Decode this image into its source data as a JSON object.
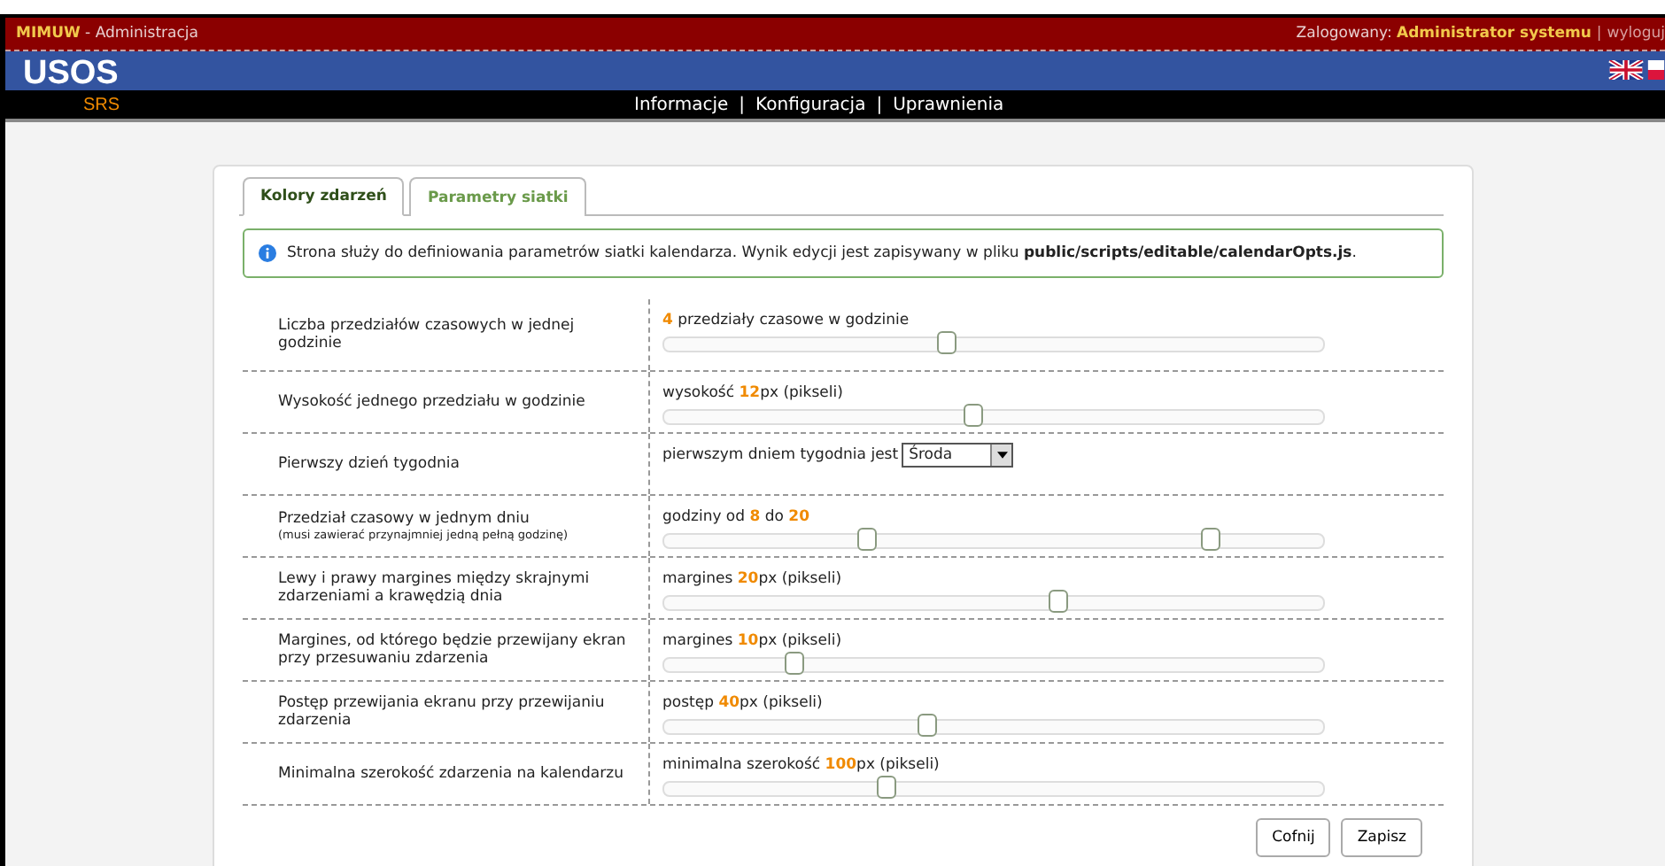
{
  "top_bar": {
    "site": "MIMUW",
    "site_suffix": " - Administracja",
    "login_label": "Zalogowany: ",
    "user": "Administrator systemu",
    "separator": "|",
    "logout": "wyloguj"
  },
  "brand": {
    "logo": "USOS",
    "sublogo": "SRS"
  },
  "nav": [
    {
      "label": "Informacje"
    },
    {
      "label": "Konfiguracja"
    },
    {
      "label": "Uprawnienia"
    }
  ],
  "nav_separator": "|",
  "tabs": [
    {
      "label": "Kolory zdarzeń",
      "selected": true
    },
    {
      "label": "Parametry siatki",
      "selected": false
    }
  ],
  "info": "Strona służy do definiowania parametrów siatki kalendarza. Wynik edycji jest zapisywany w pliku **public/scripts/editable/calendarOpts.js**.",
  "rows": [
    {
      "kind": "slider",
      "label": "Liczba przedziałów czasowych w jednej godzinie",
      "caption": [
        {
          "text": "4",
          "kind": "value"
        },
        {
          "text": " przedziały czasowe w godzinie",
          "kind": "plain"
        }
      ],
      "level": 0.43
    },
    {
      "kind": "slider",
      "label": "Wysokość jednego przedziału w godzinie",
      "caption": [
        {
          "text": "wysokość ",
          "kind": "plain"
        },
        {
          "text": "12",
          "kind": "value"
        },
        {
          "text": "px (pikseli)",
          "kind": "plain"
        }
      ],
      "level": 0.47
    },
    {
      "kind": "select",
      "label": "Pierwszy dzień tygodnia",
      "caption": [
        {
          "text": "pierwszym dniem tygodnia jest",
          "kind": "plain"
        }
      ],
      "value": "Środa"
    },
    {
      "kind": "range",
      "label": "Przedział czasowy w jednym dniu",
      "note": "(musi zawierać przynajmniej jedną pełną godzinę)",
      "caption": [
        {
          "text": "godziny od ",
          "kind": "plain"
        },
        {
          "text": "8",
          "kind": "value"
        },
        {
          "text": " do ",
          "kind": "plain"
        },
        {
          "text": "20",
          "kind": "value"
        }
      ],
      "thumbs": [
        {
          "level": 0.31
        },
        {
          "level": 0.83
        }
      ]
    },
    {
      "kind": "slider",
      "label": "Lewy i prawy margines między skrajnymi zdarzeniami a krawędzią dnia",
      "caption": [
        {
          "text": "margines ",
          "kind": "plain"
        },
        {
          "text": "20",
          "kind": "value"
        },
        {
          "text": "px (pikseli)",
          "kind": "plain"
        }
      ],
      "level": 0.6
    },
    {
      "kind": "slider",
      "label": "Margines, od którego będzie przewijany ekran przy przesuwaniu zdarzenia",
      "caption": [
        {
          "text": "margines ",
          "kind": "plain"
        },
        {
          "text": "10",
          "kind": "value"
        },
        {
          "text": "px (pikseli)",
          "kind": "plain"
        }
      ],
      "level": 0.2
    },
    {
      "kind": "slider",
      "label": "Postęp przewijania ekranu przy przewijaniu zdarzenia",
      "caption": [
        {
          "text": "postęp ",
          "kind": "plain"
        },
        {
          "text": "40",
          "kind": "value"
        },
        {
          "text": "px (pikseli)",
          "kind": "plain"
        }
      ],
      "level": 0.4
    },
    {
      "kind": "slider",
      "label": "Minimalna szerokość zdarzenia na kalendarzu",
      "caption": [
        {
          "text": "minimalna szerokość ",
          "kind": "plain"
        },
        {
          "text": "100",
          "kind": "value"
        },
        {
          "text": "px (pikseli)",
          "kind": "plain"
        }
      ],
      "level": 0.34
    }
  ],
  "buttons": [
    {
      "label": "Cofnij"
    },
    {
      "label": "Zapisz"
    }
  ]
}
